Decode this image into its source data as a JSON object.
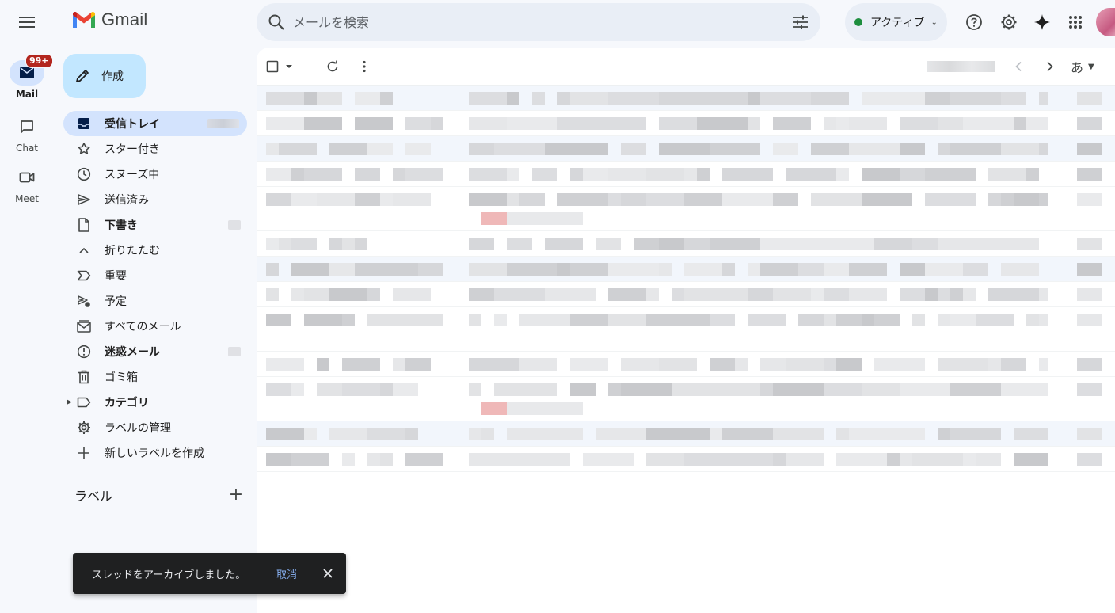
{
  "app": {
    "name": "Gmail"
  },
  "rail": {
    "items": [
      {
        "label": "Mail",
        "badge": "99+",
        "icon": "mail-icon",
        "active": true
      },
      {
        "label": "Chat",
        "icon": "chat-icon",
        "active": false
      },
      {
        "label": "Meet",
        "icon": "video-icon",
        "active": false
      }
    ]
  },
  "compose": {
    "label": "作成"
  },
  "nav": {
    "items": [
      {
        "label": "受信トレイ",
        "icon": "inbox-icon"
      },
      {
        "label": "スター付き",
        "icon": "star-icon"
      },
      {
        "label": "スヌーズ中",
        "icon": "clock-icon"
      },
      {
        "label": "送信済み",
        "icon": "send-icon"
      },
      {
        "label": "下書き",
        "icon": "draft-icon"
      },
      {
        "label": "折りたたむ",
        "icon": "chevron-up-icon"
      },
      {
        "label": "重要",
        "icon": "important-icon"
      },
      {
        "label": "予定",
        "icon": "scheduled-icon"
      },
      {
        "label": "すべてのメール",
        "icon": "all-mail-icon"
      },
      {
        "label": "迷惑メール",
        "icon": "spam-icon"
      },
      {
        "label": "ゴミ箱",
        "icon": "trash-icon"
      },
      {
        "label": "カテゴリ",
        "icon": "label-icon"
      },
      {
        "label": "ラベルの管理",
        "icon": "gear-icon"
      },
      {
        "label": "新しいラベルを作成",
        "icon": "plus-icon"
      }
    ]
  },
  "labels": {
    "title": "ラベル"
  },
  "search": {
    "placeholder": "メールを検索"
  },
  "status": {
    "label": "アクティブ",
    "color": "#1e8e3e"
  },
  "toolbar": {
    "lang": "あ"
  },
  "snackbar": {
    "message": "スレッドをアーカイブしました。",
    "undo": "取消"
  },
  "colors": {
    "accent": "#0b57d0",
    "compose_bg": "#c2e7ff",
    "active_nav": "#d3e3fd",
    "badge": "#b3261e"
  }
}
